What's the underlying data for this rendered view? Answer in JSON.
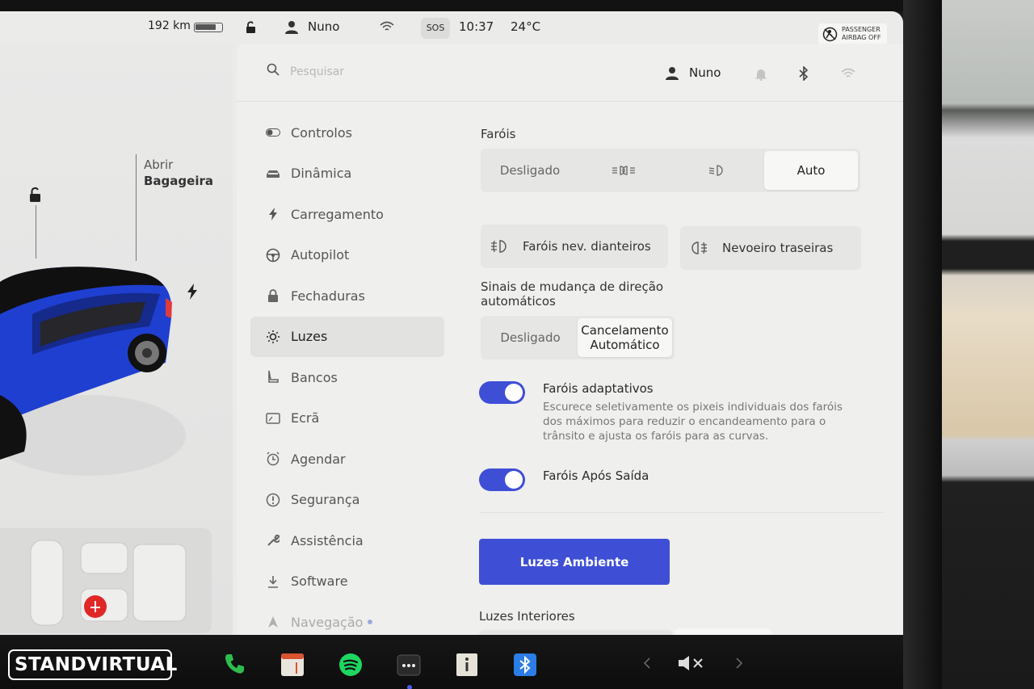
{
  "status_bar": {
    "range": "192 km",
    "battery_level": 0.8,
    "driver": "Nuno",
    "sos": "SOS",
    "time": "10:37",
    "temperature": "24°C",
    "airbag_line1": "PASSENGER",
    "airbag_line2": "AIRBAG OFF"
  },
  "car_view": {
    "trunk_line1": "Abrir",
    "trunk_line2": "Bagageira",
    "car_color": "#1f3fd1"
  },
  "topbar": {
    "search_placeholder": "Pesquisar",
    "profile_name": "Nuno"
  },
  "menu": {
    "items": [
      {
        "label": "Controlos",
        "icon": "toggle-icon"
      },
      {
        "label": "Dinâmica",
        "icon": "car-icon"
      },
      {
        "label": "Carregamento",
        "icon": "bolt-icon"
      },
      {
        "label": "Autopilot",
        "icon": "steering-wheel-icon"
      },
      {
        "label": "Fechaduras",
        "icon": "lock-icon"
      },
      {
        "label": "Luzes",
        "icon": "sun-icon"
      },
      {
        "label": "Bancos",
        "icon": "seat-icon"
      },
      {
        "label": "Ecrã",
        "icon": "display-icon"
      },
      {
        "label": "Agendar",
        "icon": "alarm-clock-icon"
      },
      {
        "label": "Segurança",
        "icon": "alert-circle-icon"
      },
      {
        "label": "Assistência",
        "icon": "wrench-icon"
      },
      {
        "label": "Software",
        "icon": "download-icon"
      },
      {
        "label": "Navegação",
        "icon": "navigation-icon"
      }
    ],
    "active": "Luzes"
  },
  "lights": {
    "headlights_label": "Faróis",
    "headlights_options": [
      "Desligado",
      "",
      "",
      "Auto"
    ],
    "headlights_selected": "Auto",
    "front_fog": "Faróis nev. dianteiros",
    "rear_fog": "Nevoeiro traseiras",
    "turn_signal_label": "Sinais de mudança de direção automáticos",
    "turn_signal_options": [
      "Desligado",
      "Cancelamento Automático"
    ],
    "turn_signal_selected": "Cancelamento Automático",
    "adaptive_title": "Faróis adaptativos",
    "adaptive_desc": "Escurece seletivamente os pixeis individuais dos faróis dos máximos para reduzir o encandeamento para o trânsito e ajusta os faróis para as curvas.",
    "adaptive_on": true,
    "after_exit_title": "Faróis Após Saída",
    "after_exit_on": true,
    "ambient_button": "Luzes Ambiente",
    "interior_label": "Luzes Interiores"
  },
  "colors": {
    "accent": "#3e4fd6",
    "background": "#efefee"
  },
  "watermark": "STANDVIRTUAL"
}
